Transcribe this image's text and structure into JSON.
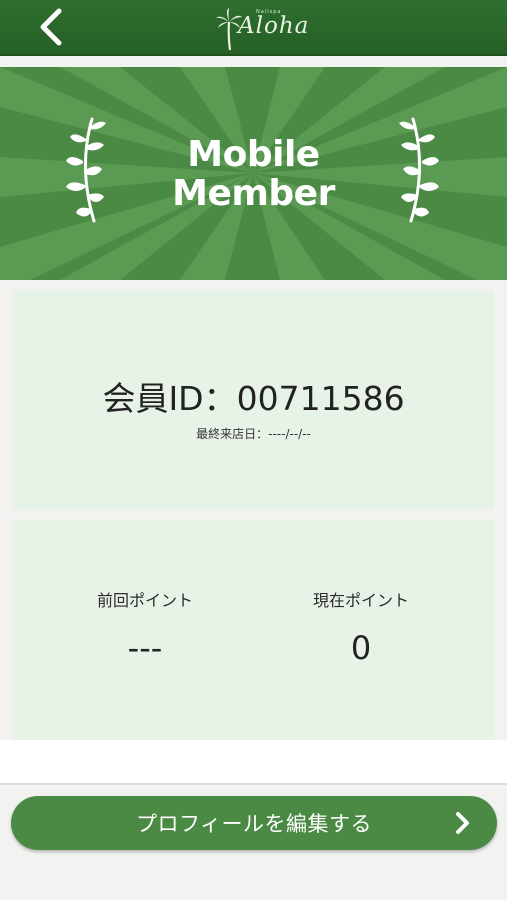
{
  "header": {
    "back_icon": "chevron-left-icon",
    "logo_tagline": "Nailspa",
    "logo_script": "Aloha"
  },
  "banner": {
    "title_line1": "Mobile",
    "title_line2": "Member",
    "decor_icon": "laurel-icon"
  },
  "member": {
    "id_label": "会員ID：",
    "id_value": "00711586",
    "last_visit_label": "最終来店日：",
    "last_visit_value": "----/--/--"
  },
  "points": {
    "previous_label": "前回ポイント",
    "previous_value": "---",
    "current_label": "現在ポイント",
    "current_value": "0"
  },
  "actions": {
    "edit_profile_label": "プロフィールを編集する",
    "edit_profile_icon": "chevron-right-icon"
  },
  "colors": {
    "header_green": "#2f6f2f",
    "banner_green": "#4b8a45",
    "panel_bg": "#e8f3e8",
    "button_green": "#4b8a45"
  }
}
